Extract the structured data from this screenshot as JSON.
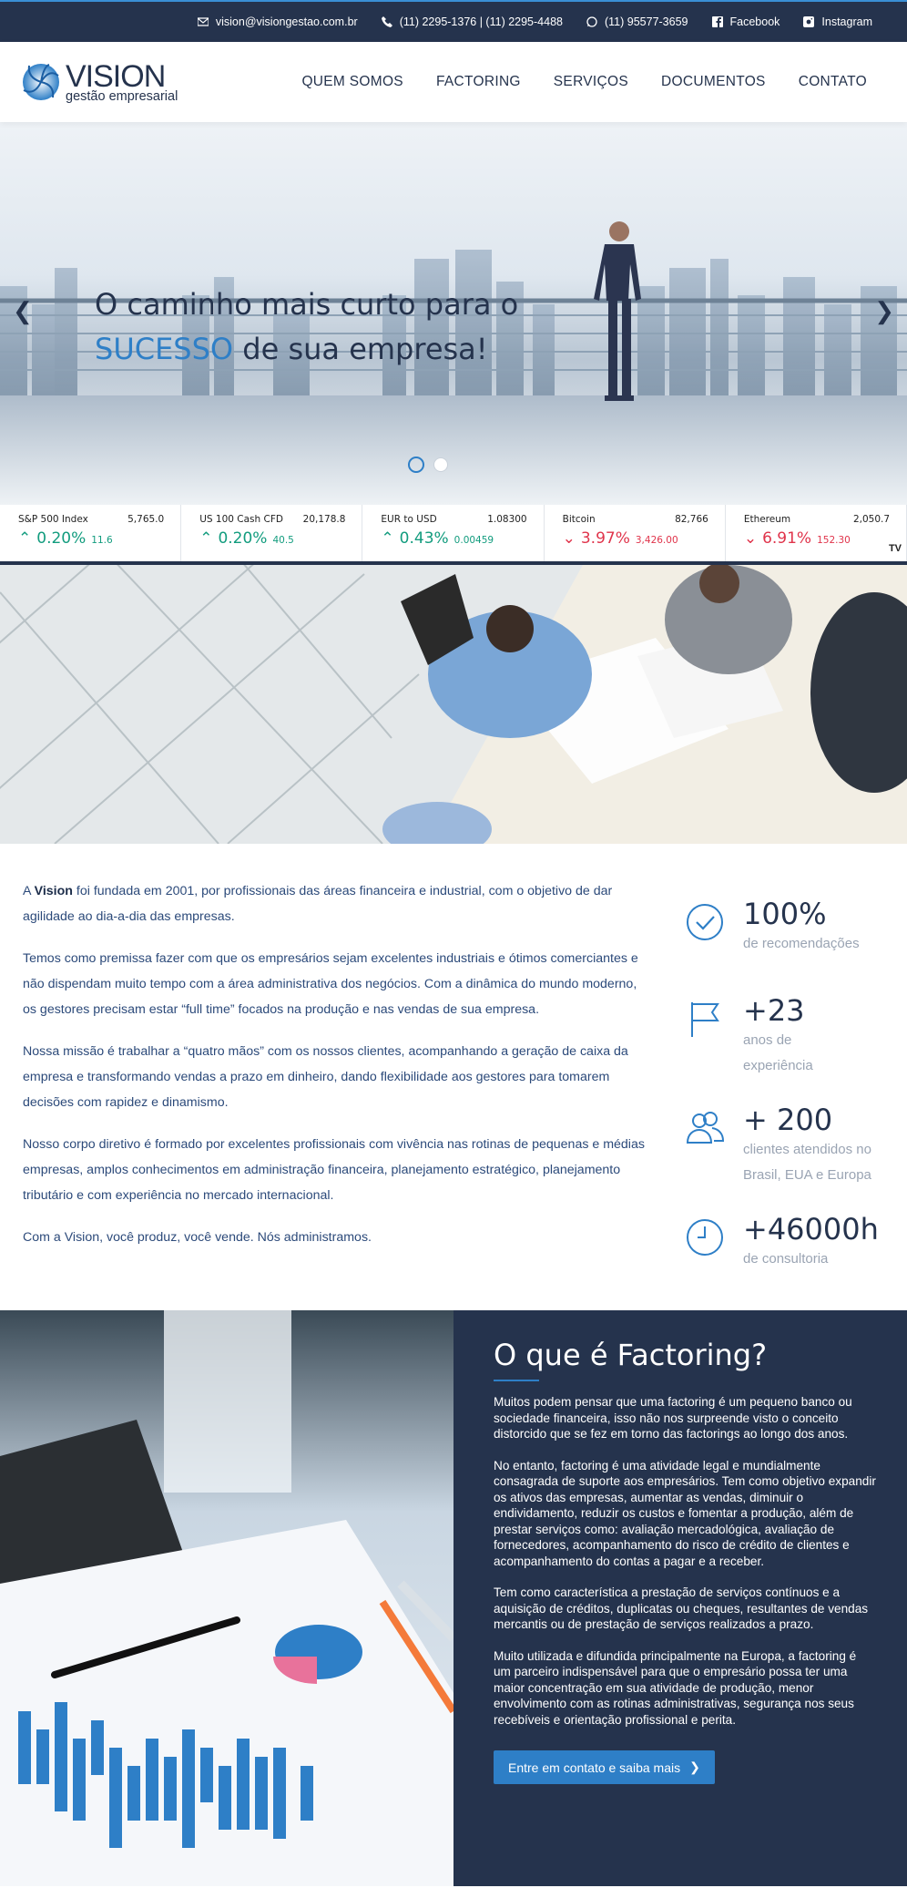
{
  "topbar": {
    "email": "vision@visiongestao.com.br",
    "phone": "(11) 2295-1376 | (11) 2295-4488",
    "whatsapp": "(11) 95577-3659",
    "facebook": "Facebook",
    "instagram": "Instagram"
  },
  "header": {
    "logo_name": "VISION",
    "logo_sub": "gestão empresarial",
    "nav": [
      "QUEM SOMOS",
      "FACTORING",
      "SERVIÇOS",
      "DOCUMENTOS",
      "CONTATO"
    ]
  },
  "hero": {
    "line1": "O caminho mais curto para o",
    "highlight": "SUCESSO",
    "line2_rest": " de sua empresa!",
    "prev_glyph": "❮",
    "next_glyph": "❯"
  },
  "ticker": [
    {
      "name": "S&P 500 Index",
      "value": "5,765.0",
      "change_pct": "0.20%",
      "change_abs": "11.6",
      "dir": "up"
    },
    {
      "name": "US 100 Cash CFD",
      "value": "20,178.8",
      "change_pct": "0.20%",
      "change_abs": "40.5",
      "dir": "up"
    },
    {
      "name": "EUR to USD",
      "value": "1.08300",
      "change_pct": "0.43%",
      "change_abs": "0.00459",
      "dir": "up"
    },
    {
      "name": "Bitcoin",
      "value": "82,766",
      "change_pct": "3.97%",
      "change_abs": "3,426.00",
      "dir": "down"
    },
    {
      "name": "Ethereum",
      "value": "2,050.7",
      "change_pct": "6.91%",
      "change_abs": "152.30",
      "dir": "down"
    }
  ],
  "ticker_logo": "TV",
  "about": {
    "p1_prefix": "A ",
    "p1_brand": "Vision",
    "p1_rest": " foi fundada em 2001, por profissionais das áreas financeira e industrial, com o objetivo de dar agilidade ao dia-a-dia das empresas.",
    "p2": "Temos como premissa fazer com que os empresários sejam excelentes industriais e ótimos comerciantes e não dispendam muito tempo com a área administrativa dos negócios. Com a dinâmica do mundo moderno, os gestores precisam estar “full time” focados na produção e nas vendas de sua empresa.",
    "p3": "Nossa missão é trabalhar a “quatro mãos” com os nossos clientes, acompanhando a geração de caixa da empresa e transformando vendas a prazo em dinheiro, dando flexibilidade aos gestores para tomarem decisões com rapidez e dinamismo.",
    "p4": "Nosso corpo diretivo é formado por excelentes profissionais com vivência nas rotinas de pequenas e médias empresas, amplos conhecimentos em administração financeira, planejamento estratégico, planejamento tributário e com experiência no mercado internacional.",
    "p5": "Com a Vision, você produz, você vende. Nós administramos."
  },
  "stats": [
    {
      "icon": "check-circle-icon",
      "number": "100%",
      "label": "de recomendações"
    },
    {
      "icon": "flag-icon",
      "number": "+23",
      "label": "anos de experiência"
    },
    {
      "icon": "users-icon",
      "number": "+ 200",
      "label": "clientes atendidos no Brasil, EUA e Europa"
    },
    {
      "icon": "clock-icon",
      "number": "+46000h",
      "label": "de consultoria"
    }
  ],
  "factoring": {
    "title": "O que é Factoring?",
    "p1": "Muitos podem pensar que uma factoring é um pequeno banco ou sociedade financeira, isso não nos surpreende visto o conceito distorcido que se fez em torno das factorings ao longo dos anos.",
    "p2": "No entanto, factoring é uma atividade legal e mundialmente consagrada de suporte aos empresários. Tem como objetivo expandir os ativos das empresas, aumentar as vendas, diminuir o endividamento, reduzir os custos e fomentar a produção, além de prestar serviços como: avaliação mercadológica, avaliação de fornecedores, acompanhamento do risco de crédito de clientes e acompanhamento do contas a pagar e a receber.",
    "p3": "Tem como característica a prestação de serviços contínuos e a aquisição de créditos, duplicatas ou cheques, resultantes de vendas mercantis ou de prestação de serviços realizados a prazo.",
    "p4": "Muito utilizada e difundida principalmente na Europa, a factoring é um parceiro indispensável para que o empresário possa ter uma maior concentração em sua atividade de produção, menor envolvimento com as rotinas administrativas, segurança nos seus recebíveis e orientação profissional e perita.",
    "button": "Entre em contato e saiba mais"
  },
  "colors": {
    "navy": "#25334d",
    "accent": "#2e7fc7",
    "up": "#129c7e",
    "down": "#e0344b"
  }
}
